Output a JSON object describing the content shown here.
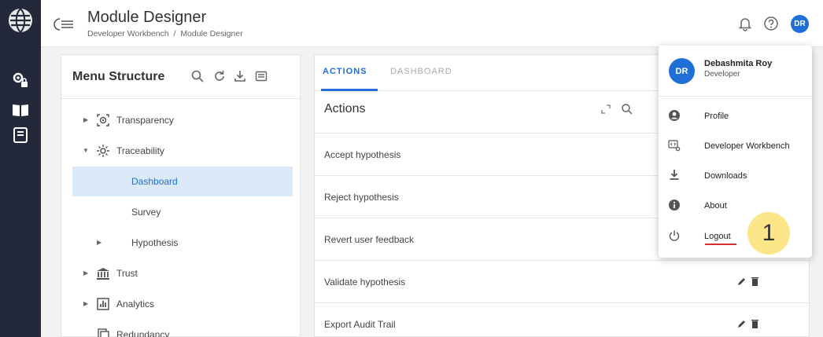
{
  "header": {
    "title": "Module Designer",
    "breadcrumb": [
      "Developer Workbench",
      "/",
      "Module Designer"
    ],
    "avatar_initials": "DR",
    "icons": [
      "menu-collapse-icon",
      "bell-icon",
      "help-icon"
    ]
  },
  "rail": {
    "icons": [
      "globe-logo-icon",
      "settings-lock-icon",
      "book-open-icon",
      "notebook-icon"
    ]
  },
  "menu_panel": {
    "title": "Menu Structure",
    "tools": [
      "search-icon",
      "refresh-icon",
      "download-icon",
      "form-icon"
    ],
    "items": [
      {
        "label": "Transparency",
        "icon": "eye-target-icon"
      },
      {
        "label": "Traceability",
        "icon": "traceability-icon"
      },
      {
        "label": "Dashboard"
      },
      {
        "label": "Survey"
      },
      {
        "label": "Hypothesis"
      },
      {
        "label": "Trust",
        "icon": "bank-icon"
      },
      {
        "label": "Analytics",
        "icon": "chart-icon"
      },
      {
        "label": "Redundancy",
        "icon": "documents-icon"
      }
    ]
  },
  "actions_panel": {
    "tabs": [
      "ACTIONS",
      "DASHBOARD"
    ],
    "title": "Actions",
    "rows": [
      "Accept hypothesis",
      "Reject hypothesis",
      "Revert user feedback",
      "Validate hypothesis",
      "Export Audit Trail"
    ]
  },
  "user_menu": {
    "initials": "DR",
    "name": "Debashmita Roy",
    "role": "Developer",
    "items": [
      {
        "label": "Profile",
        "icon": "account-circle-icon"
      },
      {
        "label": "Developer Workbench",
        "icon": "code-settings-icon"
      },
      {
        "label": "Downloads",
        "icon": "download-icon"
      },
      {
        "label": "About",
        "icon": "info-icon"
      },
      {
        "label": "Logout",
        "icon": "power-icon"
      }
    ]
  },
  "annotation": {
    "marker": "1"
  },
  "colors": {
    "rail": "#23283a",
    "accent": "#1f6fd6",
    "selected_row": "#dce9f8",
    "marker": "#fde58a",
    "logout_underline": "#d32f2f"
  }
}
